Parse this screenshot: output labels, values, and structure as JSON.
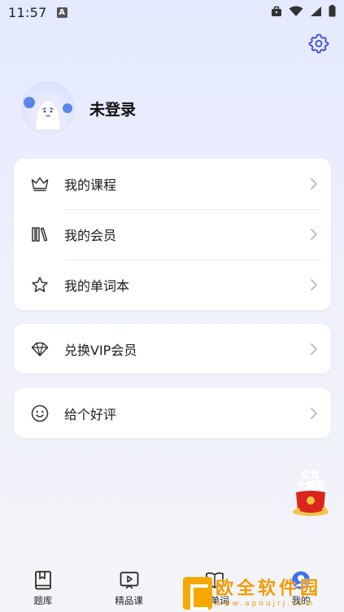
{
  "status_bar": {
    "time": "11:57",
    "notification_glyph": "A",
    "icons": [
      "briefcase-icon",
      "wifi-icon",
      "signal-icon",
      "battery-icon"
    ]
  },
  "header": {
    "settings_icon": "gear-icon"
  },
  "profile": {
    "name": "未登录"
  },
  "menu_card_1": {
    "items": [
      {
        "label": "我的课程",
        "icon": "crown-icon"
      },
      {
        "label": "我的会员",
        "icon": "books-icon"
      },
      {
        "label": "我的单词本",
        "icon": "star-icon"
      }
    ]
  },
  "menu_card_2": {
    "items": [
      {
        "label": "兑换VIP会员",
        "icon": "diamond-icon"
      }
    ]
  },
  "menu_card_3": {
    "items": [
      {
        "label": "给个好评",
        "icon": "smile-icon"
      }
    ]
  },
  "promo": {
    "line1": "红包",
    "line2": "大派送"
  },
  "bottom_nav": {
    "items": [
      {
        "label": "题库",
        "icon": "bookmark-book-icon"
      },
      {
        "label": "精品课",
        "icon": "video-play-icon"
      },
      {
        "label": "查单词",
        "icon": "open-book-icon"
      },
      {
        "label": "我的",
        "icon": "user-avatar-icon"
      }
    ]
  },
  "watermark": {
    "name": "欧全软件园",
    "url": "www.apoujrj.com"
  },
  "colors": {
    "accent_promo": "#e02b1f",
    "watermark": "#f19a00",
    "chevron": "#b7b8c0"
  }
}
